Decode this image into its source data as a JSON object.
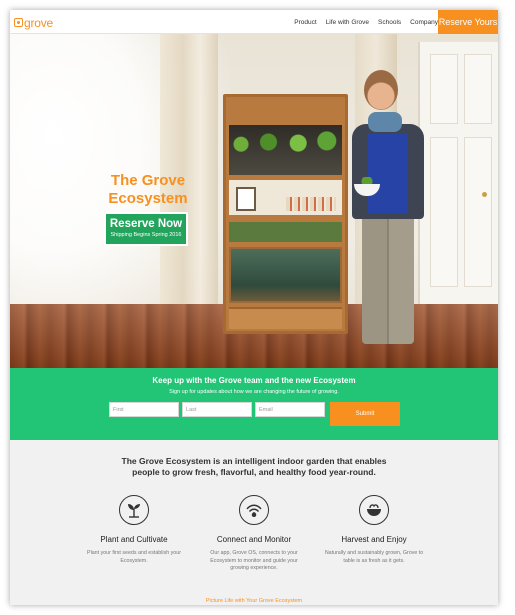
{
  "nav": {
    "logo_text": "grove",
    "links": [
      "Product",
      "Life with Grove",
      "Schools",
      "Company"
    ],
    "cta": "Reserve Yours"
  },
  "hero": {
    "title_line1": "The Grove",
    "title_line2": "Ecosystem",
    "cta_label": "Reserve Now",
    "cta_sub": "Shipping Begins Spring 2016"
  },
  "signup": {
    "title": "Keep up with the Grove team and the new Ecosystem",
    "subtitle": "Sign up for updates about how we are changing the future of growing.",
    "first_placeholder": "First",
    "last_placeholder": "Last",
    "email_placeholder": "Email",
    "submit": "Submit"
  },
  "features": {
    "intro": "The Grove Ecosystem is an intelligent indoor garden that enables people to grow fresh, flavorful, and healthy food year-round.",
    "items": [
      {
        "icon": "seedling-icon",
        "title": "Plant and Cultivate",
        "desc": "Plant your first seeds and establish your Ecosystem."
      },
      {
        "icon": "wifi-leaf-icon",
        "title": "Connect and Monitor",
        "desc": "Our app, Grove OS, connects to your Ecosystem to monitor and guide your growing experience."
      },
      {
        "icon": "bowl-icon",
        "title": "Harvest and Enjoy",
        "desc": "Naturally and sustainably grown, Grove to table is as fresh as it gets."
      }
    ],
    "link": "Picture Life with Your Grove Ecosystem"
  },
  "colors": {
    "accent": "#f7901e",
    "green": "#22c476",
    "cta_green": "#22a45d"
  }
}
